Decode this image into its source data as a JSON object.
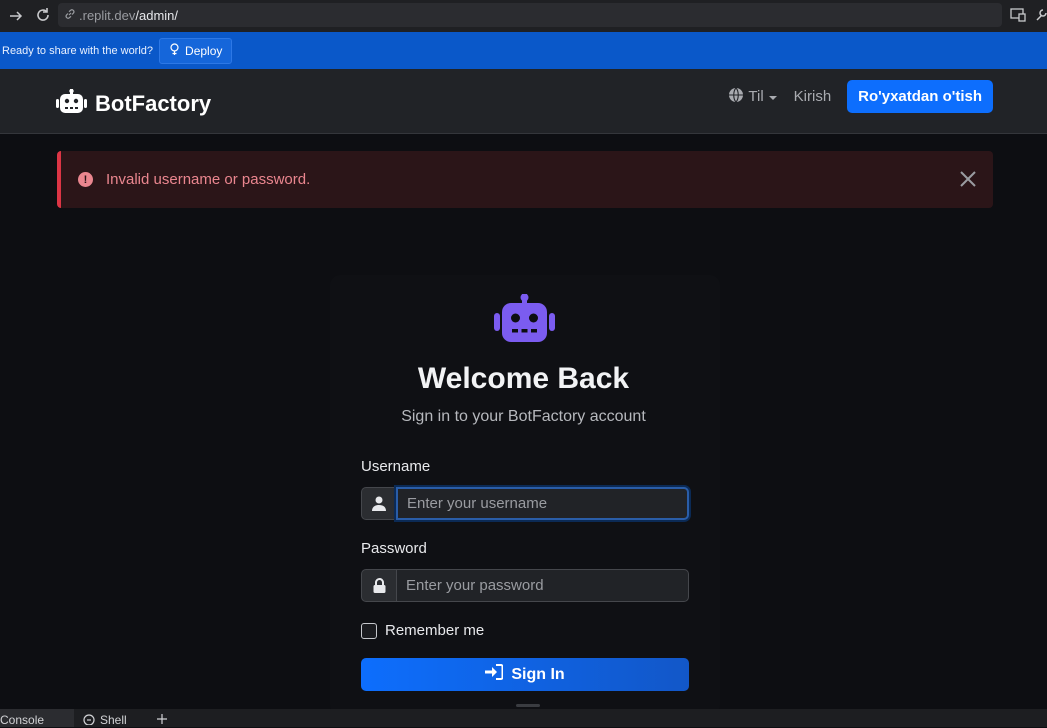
{
  "browser": {
    "url_prefix": ".replit.dev",
    "url_path": "/admin/"
  },
  "replit": {
    "share_text": "Ready to share with the world?",
    "deploy_label": "Deploy"
  },
  "nav": {
    "brand": "BotFactory",
    "language_label": "Til",
    "login_label": "Kirish",
    "signup_label": "Ro'yxatdan o'tish"
  },
  "alert": {
    "message": "Invalid username or password."
  },
  "login": {
    "title": "Welcome Back",
    "subtitle": "Sign in to your BotFactory account",
    "username_label": "Username",
    "username_placeholder": "Enter your username",
    "password_label": "Password",
    "password_placeholder": "Enter your password",
    "remember_label": "Remember me",
    "signin_label": "Sign In"
  },
  "bottom_tabs": [
    "Console",
    "Shell"
  ],
  "colors": {
    "primary": "#0d6efd",
    "danger": "#dc3545",
    "robot": "#7b5cf0"
  }
}
